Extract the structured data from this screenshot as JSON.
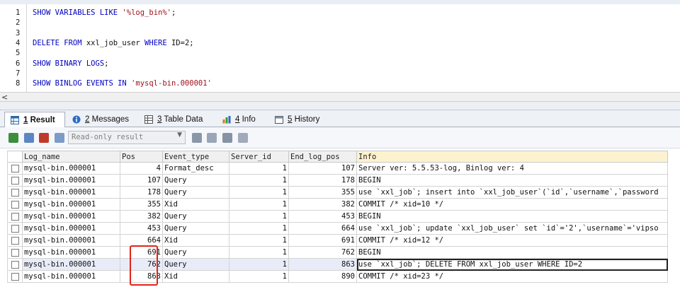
{
  "editor": {
    "lines": [
      {
        "n": "1",
        "kw": "SHOW VARIABLES LIKE ",
        "str": "'%log_bin%'",
        "tail": ";"
      },
      {
        "n": "2",
        "kw": "",
        "str": "",
        "tail": ""
      },
      {
        "n": "3",
        "kw": "",
        "str": "",
        "tail": ""
      },
      {
        "n": "4",
        "kw": "DELETE FROM ",
        "plain": "xxl_job_user ",
        "kw2": "WHERE ",
        "plain2": "ID=2;"
      },
      {
        "n": "5",
        "kw": "",
        "str": "",
        "tail": ""
      },
      {
        "n": "6",
        "kw": "SHOW BINARY LOGS",
        "str": "",
        "tail": ";"
      },
      {
        "n": "7",
        "kw": "",
        "str": "",
        "tail": ""
      },
      {
        "n": "8",
        "kw": "SHOW BINLOG EVENTS IN ",
        "str": "'mysql-bin.000001'",
        "tail": ""
      }
    ],
    "scroll_arrow": "<"
  },
  "tabs": [
    {
      "num": "1",
      "label": "Result",
      "icon": "grid-result-icon",
      "active": true
    },
    {
      "num": "2",
      "label": "Messages",
      "icon": "info-circle-icon",
      "active": false
    },
    {
      "num": "3",
      "label": "Table Data",
      "icon": "table-icon",
      "active": false
    },
    {
      "num": "4",
      "label": "Info",
      "icon": "info-chart-icon",
      "active": false
    },
    {
      "num": "5",
      "label": "History",
      "icon": "calendar-icon",
      "active": false
    }
  ],
  "toolbar": {
    "mode_select": "Read-only result"
  },
  "grid": {
    "columns": [
      "Log_name",
      "Pos",
      "Event_type",
      "Server_id",
      "End_log_pos",
      "Info"
    ],
    "rows": [
      [
        "mysql-bin.000001",
        "4",
        "Format_desc",
        "1",
        "107",
        "Server ver: 5.5.53-log, Binlog ver: 4"
      ],
      [
        "mysql-bin.000001",
        "107",
        "Query",
        "1",
        "178",
        "BEGIN"
      ],
      [
        "mysql-bin.000001",
        "178",
        "Query",
        "1",
        "355",
        "use `xxl_job`; insert into `xxl_job_user`(`id`,`username`,`password"
      ],
      [
        "mysql-bin.000001",
        "355",
        "Xid",
        "1",
        "382",
        "COMMIT /* xid=10 */"
      ],
      [
        "mysql-bin.000001",
        "382",
        "Query",
        "1",
        "453",
        "BEGIN"
      ],
      [
        "mysql-bin.000001",
        "453",
        "Query",
        "1",
        "664",
        "use `xxl_job`; update `xxl_job_user` set `id`='2',`username`='vipso"
      ],
      [
        "mysql-bin.000001",
        "664",
        "Xid",
        "1",
        "691",
        "COMMIT /* xid=12 */"
      ],
      [
        "mysql-bin.000001",
        "691",
        "Query",
        "1",
        "762",
        "BEGIN"
      ],
      [
        "mysql-bin.000001",
        "762",
        "Query",
        "1",
        "863",
        "use `xxl_job`; DELETE FROM xxl_job_user WHERE ID=2"
      ],
      [
        "mysql-bin.000001",
        "863",
        "Xid",
        "1",
        "890",
        "COMMIT /* xid=23 */"
      ]
    ],
    "selected_row": 8
  },
  "colors": {
    "keyword": "#0000c0",
    "string": "#a0111c",
    "highlight": "#e2231a",
    "info_header": "#fdf2cf"
  }
}
